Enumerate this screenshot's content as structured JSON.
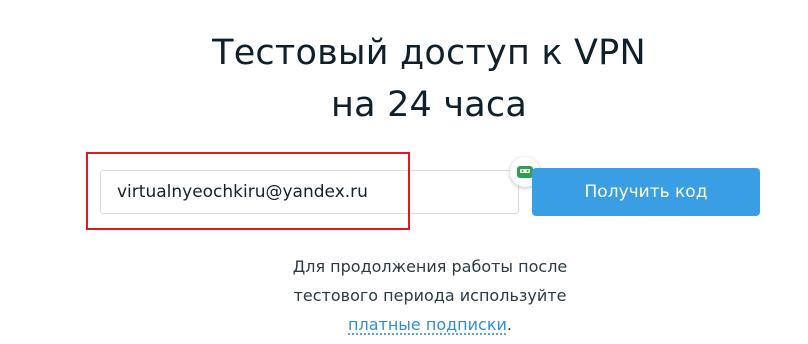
{
  "heading": {
    "line1": "Тестовый доступ к VPN",
    "line2": "на 24 часа"
  },
  "form": {
    "email_value": "virtualnyeochkiru@yandex.ru",
    "submit_label": "Получить код",
    "pw_manager_icon": "password-manager-icon"
  },
  "note": {
    "line1": "Для продолжения работы после",
    "line2": "тестового периода используйте",
    "link_text": "платные подписки",
    "trailing": "."
  },
  "colors": {
    "button": "#3a9ee4",
    "highlight": "#e0191e",
    "link": "#2f8fd6",
    "icon_green": "#2e9e4f"
  }
}
